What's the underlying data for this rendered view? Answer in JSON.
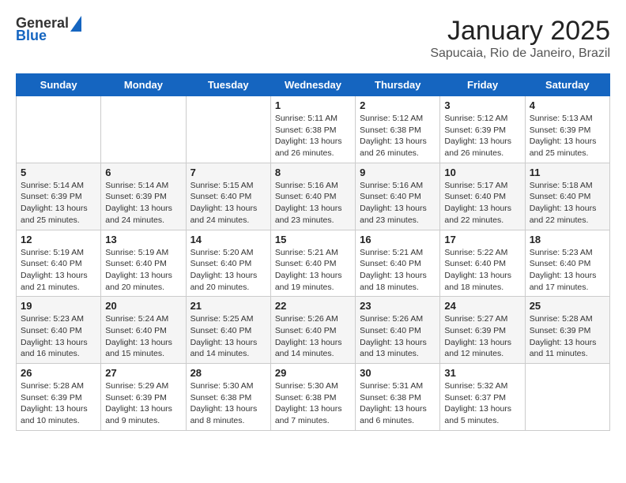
{
  "header": {
    "logo_general": "General",
    "logo_blue": "Blue",
    "title": "January 2025",
    "subtitle": "Sapucaia, Rio de Janeiro, Brazil"
  },
  "weekdays": [
    "Sunday",
    "Monday",
    "Tuesday",
    "Wednesday",
    "Thursday",
    "Friday",
    "Saturday"
  ],
  "weeks": [
    [
      {
        "day": "",
        "info": ""
      },
      {
        "day": "",
        "info": ""
      },
      {
        "day": "",
        "info": ""
      },
      {
        "day": "1",
        "info": "Sunrise: 5:11 AM\nSunset: 6:38 PM\nDaylight: 13 hours\nand 26 minutes."
      },
      {
        "day": "2",
        "info": "Sunrise: 5:12 AM\nSunset: 6:38 PM\nDaylight: 13 hours\nand 26 minutes."
      },
      {
        "day": "3",
        "info": "Sunrise: 5:12 AM\nSunset: 6:39 PM\nDaylight: 13 hours\nand 26 minutes."
      },
      {
        "day": "4",
        "info": "Sunrise: 5:13 AM\nSunset: 6:39 PM\nDaylight: 13 hours\nand 25 minutes."
      }
    ],
    [
      {
        "day": "5",
        "info": "Sunrise: 5:14 AM\nSunset: 6:39 PM\nDaylight: 13 hours\nand 25 minutes."
      },
      {
        "day": "6",
        "info": "Sunrise: 5:14 AM\nSunset: 6:39 PM\nDaylight: 13 hours\nand 24 minutes."
      },
      {
        "day": "7",
        "info": "Sunrise: 5:15 AM\nSunset: 6:40 PM\nDaylight: 13 hours\nand 24 minutes."
      },
      {
        "day": "8",
        "info": "Sunrise: 5:16 AM\nSunset: 6:40 PM\nDaylight: 13 hours\nand 23 minutes."
      },
      {
        "day": "9",
        "info": "Sunrise: 5:16 AM\nSunset: 6:40 PM\nDaylight: 13 hours\nand 23 minutes."
      },
      {
        "day": "10",
        "info": "Sunrise: 5:17 AM\nSunset: 6:40 PM\nDaylight: 13 hours\nand 22 minutes."
      },
      {
        "day": "11",
        "info": "Sunrise: 5:18 AM\nSunset: 6:40 PM\nDaylight: 13 hours\nand 22 minutes."
      }
    ],
    [
      {
        "day": "12",
        "info": "Sunrise: 5:19 AM\nSunset: 6:40 PM\nDaylight: 13 hours\nand 21 minutes."
      },
      {
        "day": "13",
        "info": "Sunrise: 5:19 AM\nSunset: 6:40 PM\nDaylight: 13 hours\nand 20 minutes."
      },
      {
        "day": "14",
        "info": "Sunrise: 5:20 AM\nSunset: 6:40 PM\nDaylight: 13 hours\nand 20 minutes."
      },
      {
        "day": "15",
        "info": "Sunrise: 5:21 AM\nSunset: 6:40 PM\nDaylight: 13 hours\nand 19 minutes."
      },
      {
        "day": "16",
        "info": "Sunrise: 5:21 AM\nSunset: 6:40 PM\nDaylight: 13 hours\nand 18 minutes."
      },
      {
        "day": "17",
        "info": "Sunrise: 5:22 AM\nSunset: 6:40 PM\nDaylight: 13 hours\nand 18 minutes."
      },
      {
        "day": "18",
        "info": "Sunrise: 5:23 AM\nSunset: 6:40 PM\nDaylight: 13 hours\nand 17 minutes."
      }
    ],
    [
      {
        "day": "19",
        "info": "Sunrise: 5:23 AM\nSunset: 6:40 PM\nDaylight: 13 hours\nand 16 minutes."
      },
      {
        "day": "20",
        "info": "Sunrise: 5:24 AM\nSunset: 6:40 PM\nDaylight: 13 hours\nand 15 minutes."
      },
      {
        "day": "21",
        "info": "Sunrise: 5:25 AM\nSunset: 6:40 PM\nDaylight: 13 hours\nand 14 minutes."
      },
      {
        "day": "22",
        "info": "Sunrise: 5:26 AM\nSunset: 6:40 PM\nDaylight: 13 hours\nand 14 minutes."
      },
      {
        "day": "23",
        "info": "Sunrise: 5:26 AM\nSunset: 6:40 PM\nDaylight: 13 hours\nand 13 minutes."
      },
      {
        "day": "24",
        "info": "Sunrise: 5:27 AM\nSunset: 6:39 PM\nDaylight: 13 hours\nand 12 minutes."
      },
      {
        "day": "25",
        "info": "Sunrise: 5:28 AM\nSunset: 6:39 PM\nDaylight: 13 hours\nand 11 minutes."
      }
    ],
    [
      {
        "day": "26",
        "info": "Sunrise: 5:28 AM\nSunset: 6:39 PM\nDaylight: 13 hours\nand 10 minutes."
      },
      {
        "day": "27",
        "info": "Sunrise: 5:29 AM\nSunset: 6:39 PM\nDaylight: 13 hours\nand 9 minutes."
      },
      {
        "day": "28",
        "info": "Sunrise: 5:30 AM\nSunset: 6:38 PM\nDaylight: 13 hours\nand 8 minutes."
      },
      {
        "day": "29",
        "info": "Sunrise: 5:30 AM\nSunset: 6:38 PM\nDaylight: 13 hours\nand 7 minutes."
      },
      {
        "day": "30",
        "info": "Sunrise: 5:31 AM\nSunset: 6:38 PM\nDaylight: 13 hours\nand 6 minutes."
      },
      {
        "day": "31",
        "info": "Sunrise: 5:32 AM\nSunset: 6:37 PM\nDaylight: 13 hours\nand 5 minutes."
      },
      {
        "day": "",
        "info": ""
      }
    ]
  ]
}
